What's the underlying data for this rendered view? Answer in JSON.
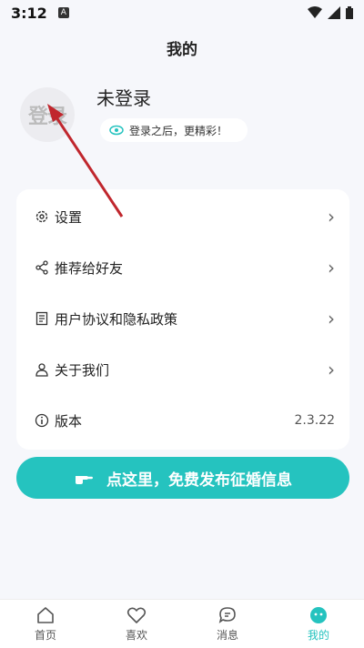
{
  "status": {
    "time": "3:12",
    "notif_badge": "A"
  },
  "header": {
    "title": "我的"
  },
  "profile": {
    "avatar_text": "登录",
    "name": "未登录",
    "hint": "登录之后，更精彩！"
  },
  "menu": {
    "items": [
      {
        "label": "设置",
        "icon": "gear-icon"
      },
      {
        "label": "推荐给好友",
        "icon": "share-icon"
      },
      {
        "label": "用户协议和隐私政策",
        "icon": "document-icon"
      },
      {
        "label": "关于我们",
        "icon": "person-icon"
      },
      {
        "label": "版本",
        "icon": "info-icon",
        "value": "2.3.22"
      }
    ]
  },
  "cta": {
    "label": "点这里，免费发布征婚信息",
    "icon": "pointing-hand-icon"
  },
  "tabbar": {
    "tabs": [
      {
        "label": "首页",
        "icon": "home-icon"
      },
      {
        "label": "喜欢",
        "icon": "heart-icon"
      },
      {
        "label": "消息",
        "icon": "message-icon"
      },
      {
        "label": "我的",
        "icon": "profile-icon",
        "active": true
      }
    ]
  },
  "colors": {
    "accent": "#25c3bf",
    "arrow": "#c0262d"
  }
}
